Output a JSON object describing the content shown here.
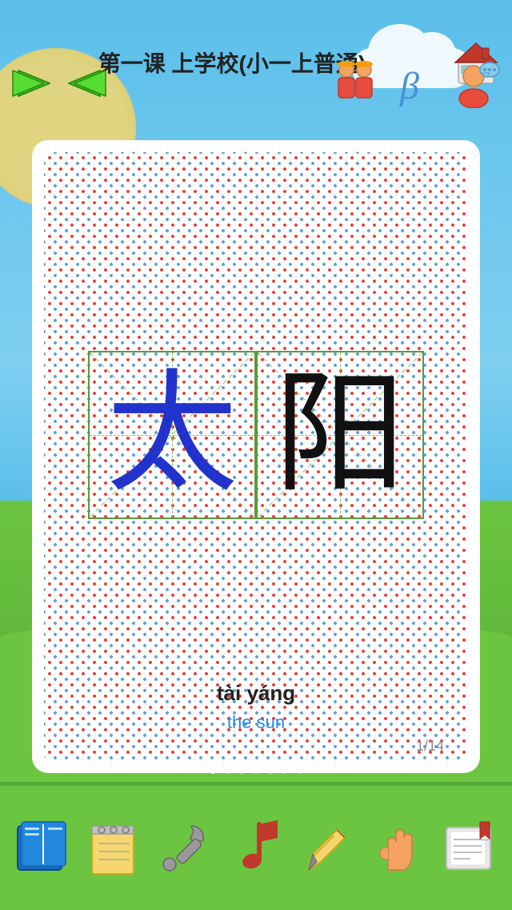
{
  "app": {
    "title": "第一课  上学校(小一上普通)"
  },
  "header": {
    "title": "第一课  上学校(小一上普通)",
    "home_label": "home"
  },
  "flashcard": {
    "characters": [
      {
        "char": "太",
        "color": "blue",
        "pinyin": "tài"
      },
      {
        "char": "阳",
        "color": "black",
        "pinyin": "yáng"
      }
    ],
    "pinyin": "tài yáng",
    "translation": "the sun",
    "card_number": "1/14"
  },
  "toolbar": {
    "items": [
      {
        "id": "book",
        "label": "书本"
      },
      {
        "id": "notepad",
        "label": "笔记本"
      },
      {
        "id": "wrench",
        "label": "工具"
      },
      {
        "id": "music",
        "label": "音乐"
      },
      {
        "id": "pencil",
        "label": "铅笔"
      },
      {
        "id": "hand",
        "label": "手"
      },
      {
        "id": "booklet",
        "label": "小书"
      }
    ]
  },
  "nav": {
    "forward_label": "前进",
    "back_label": "后退",
    "people_label": "人物",
    "beta_label": "测试版",
    "chat_label": "聊天"
  },
  "page_dots": {
    "total": 7,
    "active": 0
  }
}
